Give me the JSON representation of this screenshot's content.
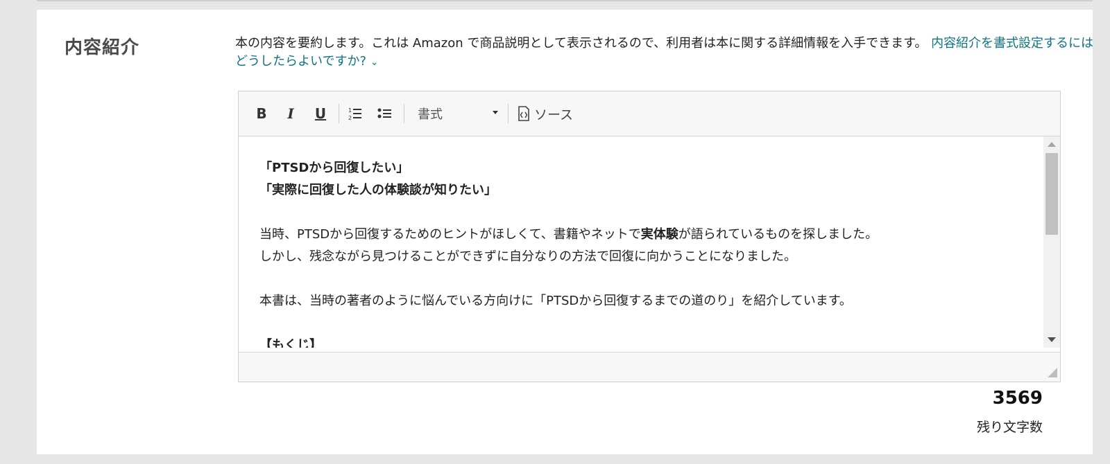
{
  "section": {
    "title": "内容紹介",
    "description": "本の内容を要約します。これは Amazon で商品説明として表示されるので、利用者は本に関する詳細情報を入手できます。",
    "help_link": "内容紹介を書式設定するにはどうしたらよいですか?"
  },
  "toolbar": {
    "bold": "B",
    "italic": "I",
    "underline": "U",
    "format_select": "書式",
    "source": "ソース"
  },
  "editor": {
    "line1": "「PTSDから回復したい」",
    "line2": "「実際に回復した人の体験談が知りたい」",
    "line3_a": "当時、PTSDから回復するためのヒントがほしくて、書籍やネットで",
    "line3_bold": "実体験",
    "line3_b": "が語られているものを探しました。",
    "line4": "しかし、残念ながら見つけることができずに自分なりの方法で回復に向かうことになりました。",
    "line5": "本書は、当時の著者のように悩んでいる方向けに「PTSDから回復するまでの道のり」を紹介しています。",
    "line6": "【もくじ】"
  },
  "counter": {
    "remaining": "3569",
    "label": "残り文字数"
  }
}
